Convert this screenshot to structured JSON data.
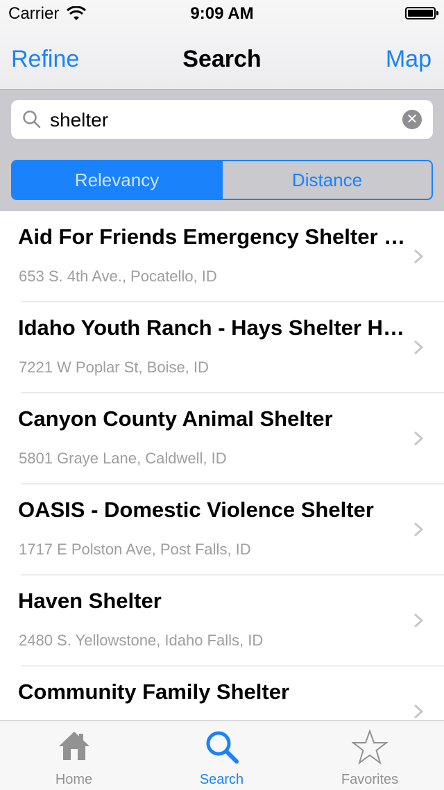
{
  "status_bar": {
    "carrier": "Carrier",
    "time": "9:09 AM"
  },
  "nav": {
    "left_label": "Refine",
    "title": "Search",
    "right_label": "Map"
  },
  "search": {
    "value": "shelter",
    "clear_icon": "clear-icon"
  },
  "sort": {
    "options": [
      "Relevancy",
      "Distance"
    ],
    "selected": "Relevancy"
  },
  "results": [
    {
      "title": "Aid For Friends Emergency Shelter Housing",
      "address": "653 S. 4th Ave., Pocatello, ID"
    },
    {
      "title": "Idaho Youth Ranch - Hays Shelter Home",
      "address": "7221 W Poplar St, Boise, ID"
    },
    {
      "title": "Canyon County Animal Shelter",
      "address": "5801 Graye Lane, Caldwell, ID"
    },
    {
      "title": "OASIS - Domestic Violence Shelter",
      "address": "1717 E Polston Ave, Post Falls, ID"
    },
    {
      "title": "Haven Shelter",
      "address": "2480 S. Yellowstone, Idaho Falls, ID"
    },
    {
      "title": "Community Family Shelter",
      "address": ""
    }
  ],
  "tabs": [
    {
      "label": "Home",
      "icon": "home-icon"
    },
    {
      "label": "Search",
      "icon": "search-icon"
    },
    {
      "label": "Favorites",
      "icon": "star-icon"
    }
  ],
  "colors": {
    "accent": "#1a82fb",
    "inactive": "#929292",
    "subtitle": "#9e9e9e"
  }
}
